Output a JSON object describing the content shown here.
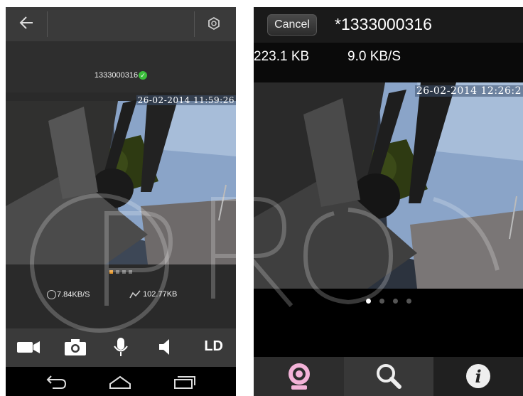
{
  "left_phone": {
    "header": {
      "back_icon": "arrow-left-icon",
      "settings_icon": "settings-icon"
    },
    "device_id": "1333000316",
    "status_icon": "check-circle-icon",
    "video": {
      "timestamp": "26-02-2014  11:59:26"
    },
    "page_dots": {
      "count": 4,
      "active": 0
    },
    "stats": {
      "speed": "7.84KB/S",
      "data": "102.77KB"
    },
    "toolbar": {
      "video_icon": "video-camera-icon",
      "photo_icon": "camera-icon",
      "mic_icon": "microphone-icon",
      "speaker_icon": "speaker-icon",
      "quality_label": "LD"
    },
    "nav": {
      "back_icon": "back-icon",
      "home_icon": "home-icon",
      "recent_icon": "recent-apps-icon"
    }
  },
  "right_phone": {
    "header": {
      "cancel_label": "Cancel",
      "title": "*1333000316"
    },
    "stats": {
      "size": "223.1 KB",
      "speed": "9.0 KB/S"
    },
    "video": {
      "timestamp": "26-02-2014  12:26:2"
    },
    "page_dots": {
      "count": 4,
      "active": 0
    },
    "tabs": [
      {
        "icon": "webcam-icon",
        "active": true
      },
      {
        "icon": "search-icon",
        "active": false
      },
      {
        "icon": "info-icon",
        "active": false
      }
    ]
  },
  "colors": {
    "accent_orange": "#e6972b",
    "tab_pink": "#f3b3d8",
    "status_green": "#3bbf3b"
  }
}
